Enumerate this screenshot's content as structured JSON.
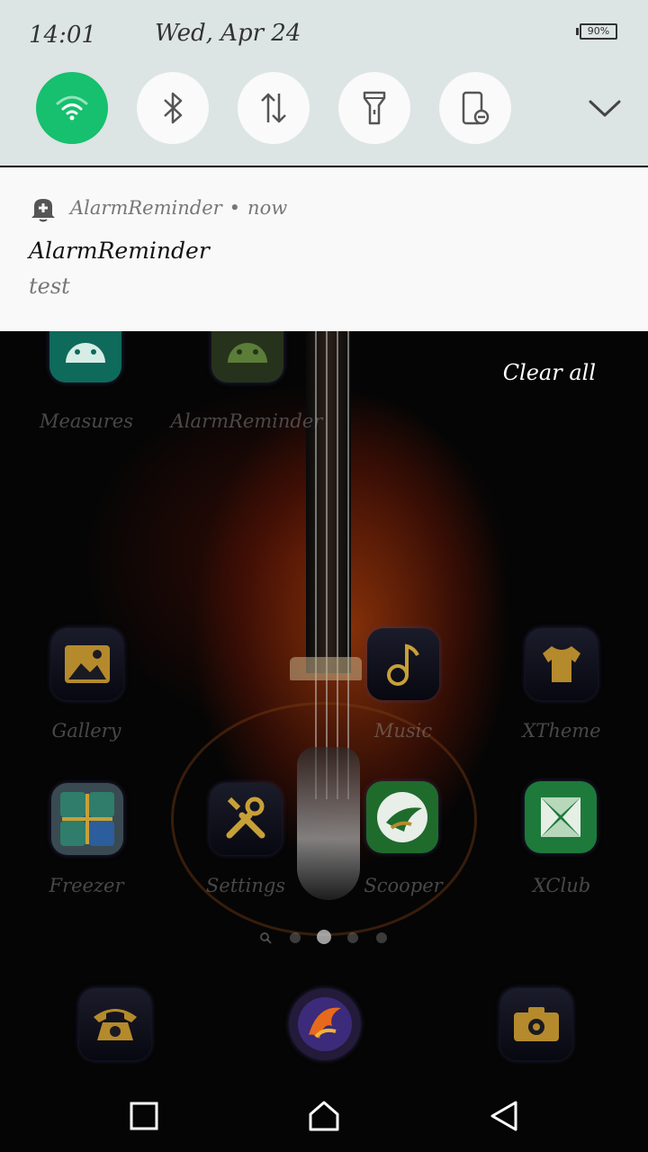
{
  "status_bar": {
    "time": "14:01",
    "date": "Wed, Apr 24",
    "battery": "90%"
  },
  "quick_settings": {
    "tiles": [
      {
        "name": "wifi",
        "icon": "wifi-icon",
        "state": "on"
      },
      {
        "name": "bluetooth",
        "icon": "bluetooth-icon",
        "state": "off"
      },
      {
        "name": "mobile-data",
        "icon": "data-arrows-icon",
        "state": "off"
      },
      {
        "name": "flashlight",
        "icon": "flashlight-icon",
        "state": "off"
      },
      {
        "name": "auto-rotate",
        "icon": "rotate-lock-icon",
        "state": "off"
      }
    ],
    "expand_icon": "chevron-down-icon",
    "accent_color": "#16c06e"
  },
  "notification": {
    "app_name": "AlarmReminder",
    "time": "now",
    "separator": "•",
    "title": "AlarmReminder",
    "text": "test",
    "icon": "alarm-bell-add-icon"
  },
  "clear_all": "Clear all",
  "home_screen": {
    "row1": [
      {
        "label": "Measures",
        "icon": "android-icon"
      },
      {
        "label": "AlarmReminder",
        "icon": "android-icon"
      }
    ],
    "row2": [
      {
        "label": "Gallery",
        "icon": "gallery-icon"
      },
      {
        "label": "Music",
        "icon": "music-note-icon"
      },
      {
        "label": "XTheme",
        "icon": "tshirt-icon"
      }
    ],
    "row3": [
      {
        "label": "Freezer",
        "icon": "freezer-folder-icon"
      },
      {
        "label": "Settings",
        "icon": "tools-icon"
      },
      {
        "label": "Scooper",
        "icon": "scooper-icon"
      },
      {
        "label": "XClub",
        "icon": "xclub-icon"
      }
    ],
    "dock": [
      {
        "icon": "phone-icon"
      },
      {
        "icon": "browser-phoenix-icon"
      },
      {
        "icon": "camera-icon"
      }
    ],
    "pages": 5,
    "active_page": 3
  },
  "nav_bar": {
    "recents": "recents-icon",
    "home": "home-icon",
    "back": "back-icon"
  }
}
